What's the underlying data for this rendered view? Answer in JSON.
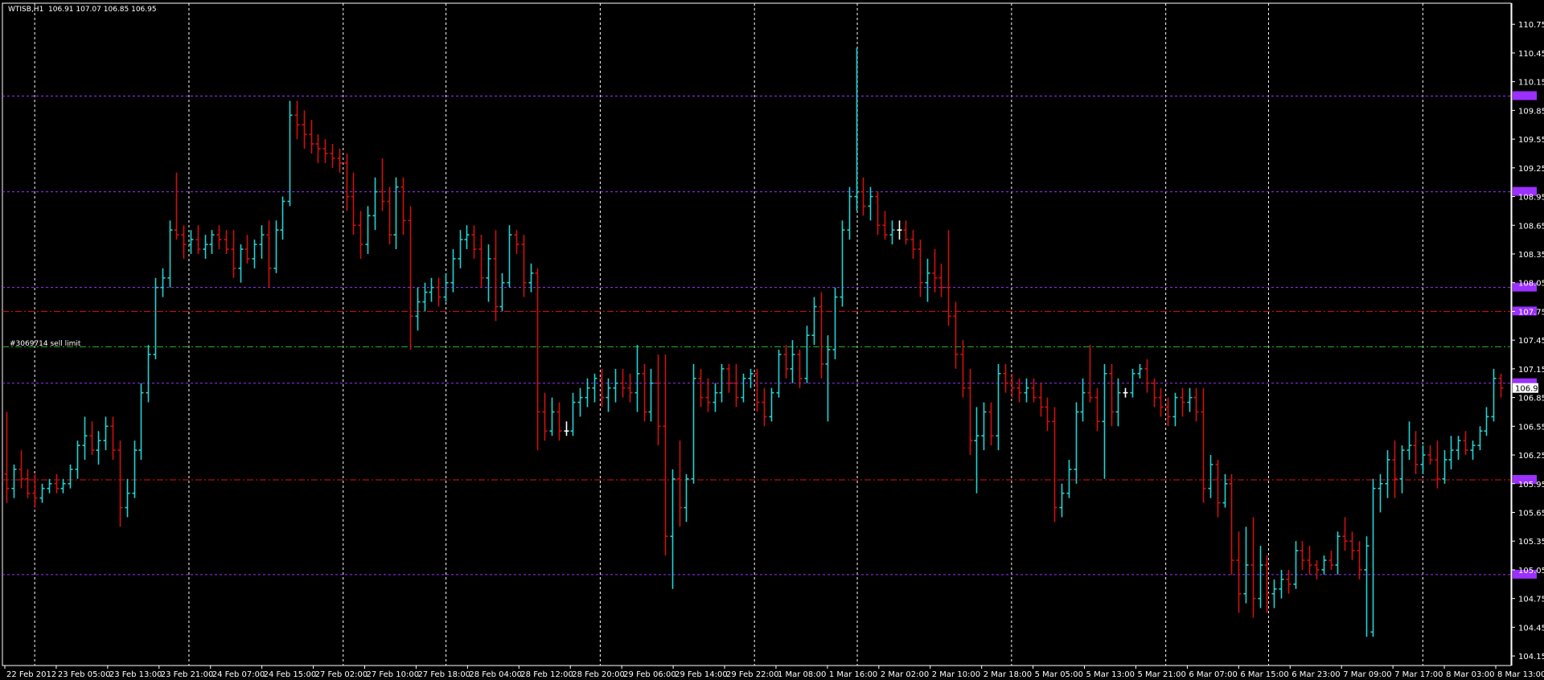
{
  "chart": {
    "symbol": "WTISB,H1",
    "ohlc_header": "106.91 107.07 106.85 106.95",
    "order_label": "#3069714 sell limit",
    "current_price": "106.95",
    "colors": {
      "background": "#000000",
      "grid": "#ffffff",
      "bull": "#22d3d3",
      "bear": "#d01010",
      "doji": "#ffffff",
      "level": "#9b30ff",
      "level_tag": "#9b30ff",
      "stop_line": "#e01010",
      "order_line": "#20b020",
      "axis": "#ffffff"
    }
  },
  "chart_data": {
    "type": "candlestick",
    "timeframe": "H1",
    "y_axis_ticks": [
      "110.75",
      "110.45",
      "110.15",
      "109.85",
      "109.55",
      "109.25",
      "108.95",
      "108.65",
      "108.35",
      "108.05",
      "107.75",
      "107.45",
      "107.15",
      "106.85",
      "106.55",
      "106.25",
      "105.95",
      "105.65",
      "105.35",
      "105.05",
      "104.75",
      "104.45",
      "104.15"
    ],
    "ylim": [
      104.05,
      110.97
    ],
    "x_axis_labels": [
      "22 Feb 2012",
      "23 Feb 05:00",
      "23 Feb 13:00",
      "23 Feb 21:00",
      "24 Feb 07:00",
      "24 Feb 15:00",
      "27 Feb 02:00",
      "27 Feb 10:00",
      "27 Feb 18:00",
      "28 Feb 04:00",
      "28 Feb 12:00",
      "28 Feb 20:00",
      "29 Feb 06:00",
      "29 Feb 14:00",
      "29 Feb 22:00",
      "1 Mar 08:00",
      "1 Mar 16:00",
      "2 Mar 02:00",
      "2 Mar 10:00",
      "2 Mar 18:00",
      "5 Mar 05:00",
      "5 Mar 13:00",
      "5 Mar 21:00",
      "6 Mar 07:00",
      "6 Mar 15:00",
      "6 Mar 23:00",
      "7 Mar 09:00",
      "7 Mar 17:00",
      "8 Mar 03:00",
      "8 Mar 13:00"
    ],
    "period_separators_after_label": [
      "22 Feb 2012",
      "23 Feb 21:00",
      "27 Feb 02:00",
      "27 Feb 18:00",
      "28 Feb 20:00",
      "29 Feb 22:00",
      "1 Mar 16:00",
      "2 Mar 18:00",
      "5 Mar 21:00",
      "6 Mar 15:00",
      "7 Mar 17:00"
    ],
    "horizontal_levels": [
      {
        "price": 110.0,
        "style": "dotted",
        "kind": "level"
      },
      {
        "price": 109.0,
        "style": "dotted",
        "kind": "level"
      },
      {
        "price": 108.0,
        "style": "dotted",
        "kind": "level"
      },
      {
        "price": 107.75,
        "style": "dash-dot",
        "kind": "stop"
      },
      {
        "price": 107.38,
        "style": "dash-dot",
        "kind": "order"
      },
      {
        "price": 107.0,
        "style": "dotted",
        "kind": "level"
      },
      {
        "price": 105.99,
        "style": "dash-dot",
        "kind": "stop"
      },
      {
        "price": 105.0,
        "style": "dotted",
        "kind": "level"
      }
    ],
    "bars": [
      [
        106.05,
        106.7,
        105.75,
        105.9
      ],
      [
        105.9,
        106.15,
        105.8,
        106.1
      ],
      [
        106.1,
        106.3,
        105.9,
        106.0
      ],
      [
        106.0,
        106.1,
        105.8,
        105.85
      ],
      [
        105.85,
        106.05,
        105.7,
        105.8
      ],
      [
        105.8,
        105.95,
        105.75,
        105.9
      ],
      [
        105.9,
        106.0,
        105.85,
        105.95
      ],
      [
        105.95,
        106.05,
        105.85,
        105.9
      ],
      [
        105.9,
        106.0,
        105.85,
        105.95
      ],
      [
        105.95,
        106.15,
        105.9,
        106.1
      ],
      [
        106.1,
        106.4,
        106.0,
        106.35
      ],
      [
        106.35,
        106.65,
        106.2,
        106.45
      ],
      [
        106.45,
        106.6,
        106.25,
        106.3
      ],
      [
        106.3,
        106.5,
        106.15,
        106.4
      ],
      [
        106.4,
        106.65,
        106.3,
        106.55
      ],
      [
        106.55,
        106.65,
        106.2,
        106.3
      ],
      [
        106.3,
        106.4,
        105.5,
        105.7
      ],
      [
        105.7,
        106.0,
        105.6,
        105.85
      ],
      [
        105.85,
        106.4,
        105.8,
        106.3
      ],
      [
        106.3,
        107.0,
        106.2,
        106.9
      ],
      [
        106.9,
        107.4,
        106.8,
        107.3
      ],
      [
        107.3,
        108.1,
        107.25,
        108.0
      ],
      [
        108.0,
        108.2,
        107.9,
        108.1
      ],
      [
        108.1,
        108.7,
        108.0,
        108.6
      ],
      [
        108.6,
        109.2,
        108.5,
        108.55
      ],
      [
        108.55,
        108.65,
        108.3,
        108.45
      ],
      [
        108.45,
        108.6,
        108.35,
        108.5
      ],
      [
        108.5,
        108.65,
        108.35,
        108.4
      ],
      [
        108.4,
        108.55,
        108.3,
        108.45
      ],
      [
        108.45,
        108.6,
        108.35,
        108.55
      ],
      [
        108.55,
        108.65,
        108.4,
        108.5
      ],
      [
        108.5,
        108.6,
        108.35,
        108.4
      ],
      [
        108.4,
        108.6,
        108.1,
        108.2
      ],
      [
        108.2,
        108.45,
        108.05,
        108.4
      ],
      [
        108.4,
        108.55,
        108.25,
        108.3
      ],
      [
        108.3,
        108.5,
        108.2,
        108.45
      ],
      [
        108.45,
        108.65,
        108.3,
        108.55
      ],
      [
        108.55,
        108.7,
        108.0,
        108.2
      ],
      [
        108.2,
        108.7,
        108.15,
        108.6
      ],
      [
        108.6,
        108.95,
        108.5,
        108.9
      ],
      [
        108.9,
        109.95,
        108.85,
        109.8
      ],
      [
        109.8,
        109.95,
        109.55,
        109.7
      ],
      [
        109.7,
        109.85,
        109.45,
        109.6
      ],
      [
        109.6,
        109.75,
        109.4,
        109.5
      ],
      [
        109.5,
        109.6,
        109.3,
        109.45
      ],
      [
        109.45,
        109.55,
        109.3,
        109.4
      ],
      [
        109.4,
        109.5,
        109.25,
        109.35
      ],
      [
        109.35,
        109.45,
        109.2,
        109.3
      ],
      [
        109.3,
        109.4,
        108.8,
        108.95
      ],
      [
        108.95,
        109.2,
        108.55,
        108.65
      ],
      [
        108.65,
        108.8,
        108.3,
        108.45
      ],
      [
        108.45,
        108.85,
        108.35,
        108.75
      ],
      [
        108.75,
        109.15,
        108.6,
        109.0
      ],
      [
        109.0,
        109.35,
        108.8,
        108.9
      ],
      [
        108.9,
        109.05,
        108.45,
        108.55
      ],
      [
        108.55,
        109.15,
        108.4,
        109.05
      ],
      [
        109.05,
        109.15,
        108.55,
        108.7
      ],
      [
        108.7,
        108.85,
        107.35,
        107.7
      ],
      [
        107.7,
        108.0,
        107.55,
        107.85
      ],
      [
        107.85,
        108.05,
        107.75,
        107.95
      ],
      [
        107.95,
        108.1,
        107.85,
        108.0
      ],
      [
        108.0,
        108.1,
        107.8,
        107.9
      ],
      [
        107.9,
        108.15,
        107.85,
        108.05
      ],
      [
        108.05,
        108.4,
        107.95,
        108.3
      ],
      [
        108.3,
        108.6,
        108.2,
        108.5
      ],
      [
        108.5,
        108.65,
        108.4,
        108.55
      ],
      [
        108.55,
        108.65,
        108.3,
        108.4
      ],
      [
        108.4,
        108.55,
        108.0,
        108.1
      ],
      [
        108.1,
        108.45,
        107.85,
        108.3
      ],
      [
        108.3,
        108.6,
        107.65,
        107.8
      ],
      [
        107.8,
        108.15,
        107.75,
        108.05
      ],
      [
        108.05,
        108.65,
        108.0,
        108.55
      ],
      [
        108.55,
        108.6,
        108.35,
        108.45
      ],
      [
        108.45,
        108.55,
        107.9,
        108.05
      ],
      [
        108.05,
        108.25,
        107.95,
        108.15
      ],
      [
        108.15,
        108.2,
        106.3,
        106.7
      ],
      [
        106.7,
        106.9,
        106.4,
        106.5
      ],
      [
        106.5,
        106.85,
        106.45,
        106.7
      ],
      [
        106.7,
        106.8,
        106.4,
        106.5
      ],
      [
        106.5,
        106.6,
        106.45,
        106.5
      ],
      [
        106.5,
        106.9,
        106.45,
        106.8
      ],
      [
        106.8,
        106.95,
        106.65,
        106.85
      ],
      [
        106.85,
        107.05,
        106.75,
        106.95
      ],
      [
        106.95,
        107.1,
        106.8,
        107.05
      ],
      [
        107.05,
        107.15,
        106.75,
        106.85
      ],
      [
        106.85,
        107.05,
        106.7,
        106.95
      ],
      [
        106.95,
        107.15,
        106.8,
        107.0
      ],
      [
        107.0,
        107.15,
        106.85,
        106.95
      ],
      [
        106.95,
        107.1,
        106.8,
        106.9
      ],
      [
        106.9,
        107.4,
        106.7,
        107.1
      ],
      [
        107.1,
        107.2,
        106.6,
        106.7
      ],
      [
        106.7,
        107.15,
        106.6,
        107.0
      ],
      [
        107.0,
        107.3,
        106.35,
        106.55
      ],
      [
        106.55,
        107.3,
        105.2,
        105.4
      ],
      [
        105.4,
        106.1,
        104.85,
        106.0
      ],
      [
        106.0,
        106.4,
        105.5,
        105.7
      ],
      [
        105.7,
        106.05,
        105.55,
        106.0
      ],
      [
        106.0,
        107.2,
        105.95,
        107.05
      ],
      [
        107.05,
        107.15,
        106.75,
        106.85
      ],
      [
        106.85,
        107.05,
        106.7,
        106.8
      ],
      [
        106.8,
        107.0,
        106.7,
        106.9
      ],
      [
        106.9,
        107.2,
        106.8,
        107.15
      ],
      [
        107.15,
        107.2,
        106.9,
        107.0
      ],
      [
        107.0,
        107.2,
        106.75,
        106.85
      ],
      [
        106.85,
        107.1,
        106.8,
        107.05
      ],
      [
        107.05,
        107.15,
        106.95,
        107.1
      ],
      [
        107.1,
        107.15,
        106.7,
        106.8
      ],
      [
        106.8,
        106.95,
        106.55,
        106.65
      ],
      [
        106.65,
        106.95,
        106.6,
        106.9
      ],
      [
        106.9,
        107.35,
        106.85,
        107.3
      ],
      [
        107.3,
        107.4,
        107.05,
        107.15
      ],
      [
        107.15,
        107.45,
        107.0,
        107.3
      ],
      [
        107.3,
        107.35,
        106.95,
        107.05
      ],
      [
        107.05,
        107.6,
        107.0,
        107.5
      ],
      [
        107.5,
        107.9,
        107.4,
        107.8
      ],
      [
        107.8,
        107.95,
        107.05,
        107.2
      ],
      [
        107.2,
        107.5,
        106.6,
        107.35
      ],
      [
        107.35,
        108.0,
        107.25,
        107.9
      ],
      [
        107.9,
        108.7,
        107.8,
        108.6
      ],
      [
        108.6,
        109.05,
        108.5,
        108.95
      ],
      [
        108.95,
        110.5,
        108.8,
        109.0
      ],
      [
        109.0,
        109.15,
        108.75,
        108.85
      ],
      [
        108.85,
        109.05,
        108.7,
        108.95
      ],
      [
        108.95,
        109.0,
        108.55,
        108.65
      ],
      [
        108.65,
        108.8,
        108.5,
        108.55
      ],
      [
        108.55,
        108.7,
        108.45,
        108.6
      ],
      [
        108.6,
        108.7,
        108.5,
        108.6
      ],
      [
        108.6,
        108.7,
        108.45,
        108.5
      ],
      [
        108.5,
        108.6,
        108.3,
        108.4
      ],
      [
        108.4,
        108.5,
        107.9,
        108.05
      ],
      [
        108.05,
        108.3,
        107.85,
        108.15
      ],
      [
        108.15,
        108.4,
        107.95,
        108.1
      ],
      [
        108.1,
        108.25,
        107.9,
        108.0
      ],
      [
        108.0,
        108.6,
        107.6,
        107.7
      ],
      [
        107.7,
        107.85,
        107.15,
        107.3
      ],
      [
        107.3,
        107.45,
        106.85,
        106.95
      ],
      [
        106.95,
        107.15,
        106.25,
        106.4
      ],
      [
        106.4,
        106.75,
        105.85,
        106.45
      ],
      [
        106.45,
        106.8,
        106.3,
        106.7
      ],
      [
        106.7,
        106.8,
        106.35,
        106.45
      ],
      [
        106.45,
        107.2,
        106.3,
        107.1
      ],
      [
        107.1,
        107.2,
        106.9,
        107.0
      ],
      [
        107.0,
        107.1,
        106.85,
        106.95
      ],
      [
        106.95,
        107.05,
        106.8,
        106.9
      ],
      [
        106.9,
        107.05,
        106.8,
        106.95
      ],
      [
        106.95,
        107.05,
        106.8,
        106.85
      ],
      [
        106.85,
        107.0,
        106.65,
        106.75
      ],
      [
        106.75,
        106.85,
        106.5,
        106.6
      ],
      [
        106.6,
        106.75,
        105.55,
        105.7
      ],
      [
        105.7,
        105.95,
        105.6,
        105.85
      ],
      [
        105.85,
        106.2,
        105.8,
        106.1
      ],
      [
        106.1,
        106.8,
        105.95,
        106.7
      ],
      [
        106.7,
        107.05,
        106.6,
        106.9
      ],
      [
        106.9,
        107.4,
        106.8,
        106.85
      ],
      [
        106.85,
        106.95,
        106.5,
        106.6
      ],
      [
        106.6,
        107.2,
        106.0,
        107.1
      ],
      [
        107.1,
        107.2,
        106.55,
        106.7
      ],
      [
        106.7,
        107.05,
        106.55,
        106.9
      ],
      [
        106.9,
        106.95,
        106.85,
        106.9
      ],
      [
        106.9,
        107.15,
        106.85,
        107.1
      ],
      [
        107.1,
        107.2,
        107.05,
        107.15
      ],
      [
        107.15,
        107.25,
        106.9,
        107.0
      ],
      [
        107.0,
        107.05,
        106.75,
        106.85
      ],
      [
        106.85,
        106.95,
        106.65,
        106.75
      ],
      [
        106.75,
        106.85,
        106.55,
        106.65
      ],
      [
        106.65,
        106.9,
        106.55,
        106.85
      ],
      [
        106.85,
        106.95,
        106.65,
        106.8
      ],
      [
        106.8,
        106.95,
        106.7,
        106.85
      ],
      [
        106.85,
        106.95,
        106.6,
        106.7
      ],
      [
        106.7,
        106.95,
        105.75,
        105.9
      ],
      [
        105.9,
        106.25,
        105.8,
        106.15
      ],
      [
        106.15,
        106.2,
        105.6,
        105.75
      ],
      [
        105.75,
        106.05,
        105.7,
        105.95
      ],
      [
        105.95,
        106.05,
        105.0,
        105.15
      ],
      [
        105.15,
        105.45,
        104.6,
        104.8
      ],
      [
        104.8,
        105.5,
        104.7,
        105.1
      ],
      [
        105.1,
        105.6,
        104.55,
        104.75
      ],
      [
        104.75,
        105.3,
        104.65,
        105.1
      ],
      [
        105.1,
        105.2,
        104.6,
        104.8
      ],
      [
        104.8,
        104.95,
        104.65,
        104.85
      ],
      [
        104.85,
        105.05,
        104.75,
        104.95
      ],
      [
        104.95,
        105.05,
        104.8,
        104.9
      ],
      [
        104.9,
        105.35,
        104.85,
        105.25
      ],
      [
        105.25,
        105.35,
        105.05,
        105.15
      ],
      [
        105.15,
        105.3,
        105.0,
        105.1
      ],
      [
        105.1,
        105.15,
        104.95,
        105.05
      ],
      [
        105.05,
        105.2,
        105.0,
        105.15
      ],
      [
        105.15,
        105.25,
        105.05,
        105.1
      ],
      [
        105.1,
        105.45,
        105.0,
        105.4
      ],
      [
        105.4,
        105.6,
        105.25,
        105.35
      ],
      [
        105.35,
        105.45,
        105.15,
        105.25
      ],
      [
        105.25,
        105.35,
        104.95,
        105.05
      ],
      [
        105.05,
        105.4,
        104.35,
        105.3
      ],
      [
        104.4,
        106.0,
        104.35,
        105.9
      ],
      [
        105.9,
        106.05,
        105.65,
        105.95
      ],
      [
        105.95,
        106.3,
        105.8,
        106.2
      ],
      [
        106.2,
        106.4,
        105.8,
        106.0
      ],
      [
        106.0,
        106.35,
        105.85,
        106.3
      ],
      [
        106.3,
        106.6,
        106.2,
        106.35
      ],
      [
        106.35,
        106.5,
        106.05,
        106.15
      ],
      [
        106.15,
        106.35,
        106.05,
        106.25
      ],
      [
        106.25,
        106.35,
        106.15,
        106.2
      ],
      [
        106.2,
        106.4,
        105.9,
        106.0
      ],
      [
        106.0,
        106.3,
        105.95,
        106.2
      ],
      [
        106.2,
        106.45,
        106.1,
        106.3
      ],
      [
        106.3,
        106.45,
        106.2,
        106.4
      ],
      [
        106.4,
        106.5,
        106.25,
        106.3
      ],
      [
        106.3,
        106.4,
        106.2,
        106.35
      ],
      [
        106.35,
        106.55,
        106.3,
        106.5
      ],
      [
        106.5,
        106.75,
        106.45,
        106.65
      ],
      [
        106.65,
        107.15,
        106.6,
        107.05
      ],
      [
        107.05,
        107.1,
        106.85,
        106.95
      ]
    ]
  }
}
